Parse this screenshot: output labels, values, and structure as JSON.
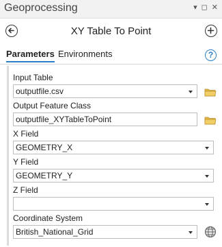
{
  "window": {
    "title": "Geoprocessing",
    "controls": [
      "▾",
      "◻",
      "✕"
    ]
  },
  "tool": {
    "title": "XY Table To Point",
    "back_icon": "back-arrow-icon",
    "add_icon": "plus-circle-icon"
  },
  "tabs": [
    {
      "label": "Parameters",
      "active": true
    },
    {
      "label": "Environments",
      "active": false
    }
  ],
  "help": {
    "label": "?"
  },
  "colors": {
    "accent": "#2a7fc8",
    "folder": "#e0b84a"
  },
  "params": {
    "input_table": {
      "label": "Input Table",
      "value": "outputfile.csv"
    },
    "output_feature_class": {
      "label": "Output Feature Class",
      "value": "outputfile_XYTableToPoint"
    },
    "x_field": {
      "label": "X Field",
      "value": "GEOMETRY_X"
    },
    "y_field": {
      "label": "Y Field",
      "value": "GEOMETRY_Y"
    },
    "z_field": {
      "label": "Z Field",
      "value": ""
    },
    "coordinate_system": {
      "label": "Coordinate System",
      "value": "British_National_Grid"
    }
  }
}
